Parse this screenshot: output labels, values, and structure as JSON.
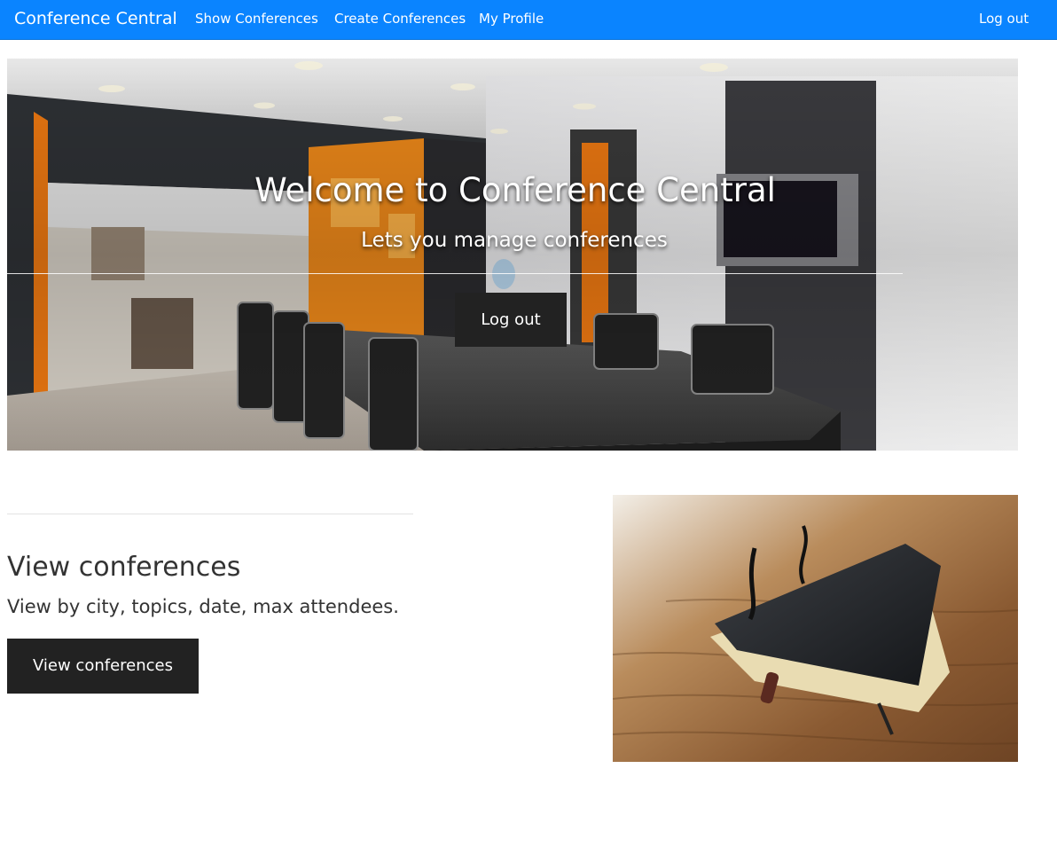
{
  "navbar": {
    "brand": "Conference Central",
    "links": [
      {
        "label": "Show Conferences"
      },
      {
        "label": "Create Conferences"
      },
      {
        "label": "My Profile"
      }
    ],
    "logout_label": "Log out",
    "color": "#0a84ff"
  },
  "hero": {
    "title": "Welcome to Conference Central",
    "subtitle": "Lets you manage conferences",
    "button_label": "Log out",
    "image_icon": "conference-room-photo"
  },
  "section": {
    "heading": "View conferences",
    "lead": "View by city, topics, date, max attendees.",
    "button_label": "View conferences",
    "image_icon": "notebook-photo"
  },
  "colors": {
    "accent": "#0a84ff",
    "button_bg": "#222222",
    "text": "#333333"
  }
}
